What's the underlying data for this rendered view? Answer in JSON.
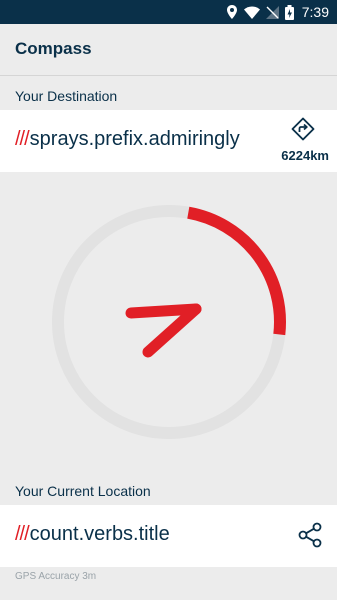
{
  "status_bar": {
    "time": "7:39",
    "icons": [
      "location-icon",
      "wifi-icon",
      "signal-icon",
      "battery-icon"
    ]
  },
  "app": {
    "title": "Compass"
  },
  "destination": {
    "section_label": "Your Destination",
    "slashes": "///",
    "words": "sprays.prefix.admiringly",
    "distance": "6224km",
    "icon": "directions-icon"
  },
  "compass": {
    "progress_fraction": 0.24
  },
  "current_location": {
    "section_label": "Your Current Location",
    "slashes": "///",
    "words": "count.verbs.title",
    "icon": "share-icon"
  },
  "footer": {
    "gps_accuracy": "GPS Accuracy 3m"
  },
  "colors": {
    "brand_dark": "#0a3049",
    "accent_red": "#e11f26",
    "background": "#ececec",
    "ring": "#e2e2e2"
  }
}
